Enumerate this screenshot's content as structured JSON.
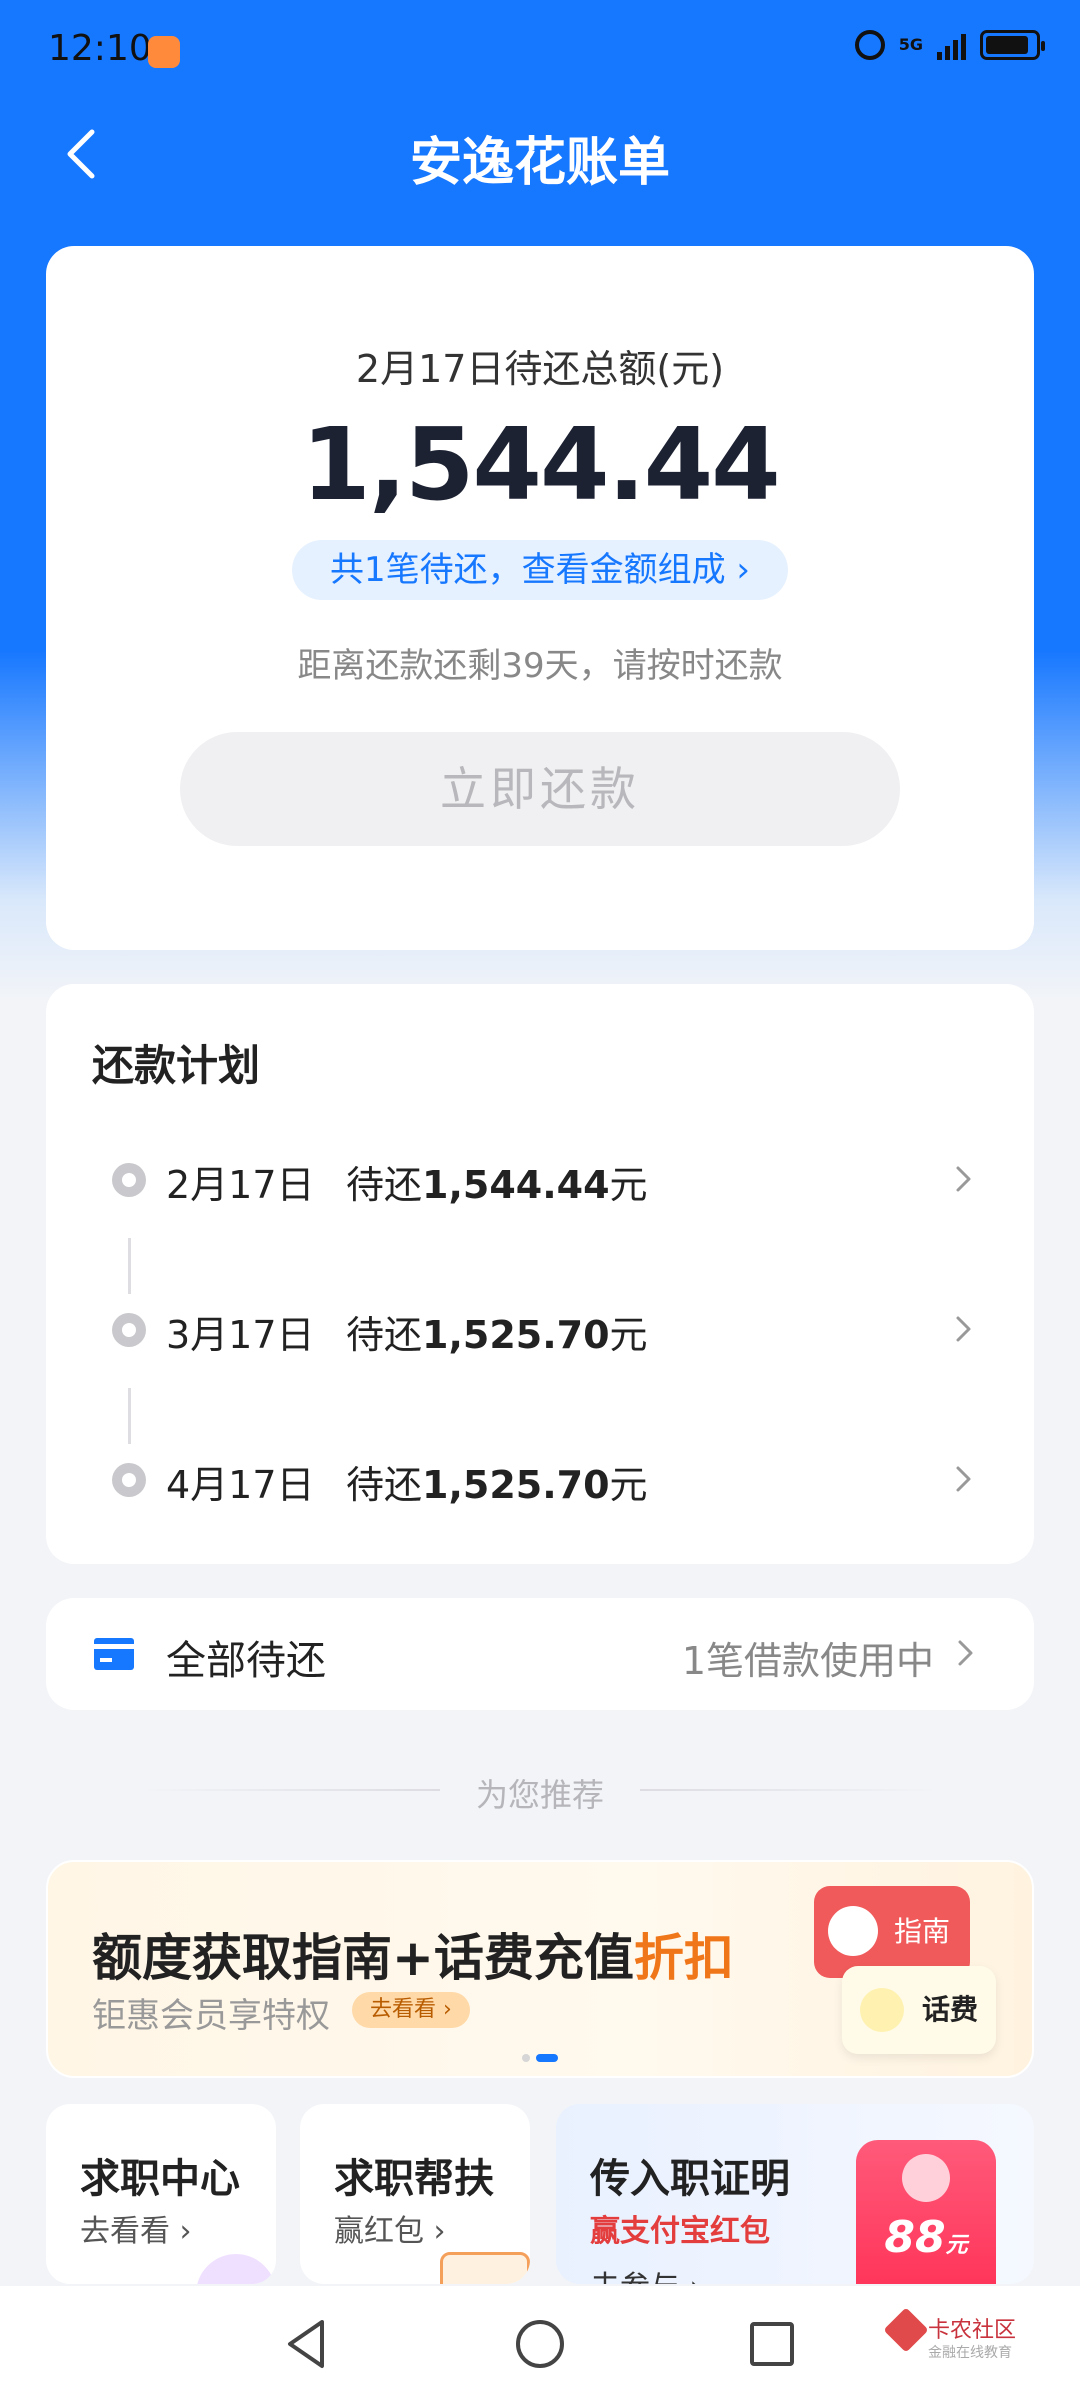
{
  "status_bar": {
    "time": "12:10",
    "network": "5G"
  },
  "header": {
    "title": "安逸花账单"
  },
  "summary": {
    "due_title": "2月17日待还总额(元)",
    "amount": "1,544.44",
    "breakdown_link": "共1笔待还，查看金额组成 ›",
    "remaining_text": "距离还款还剩39天，请按时还款",
    "pay_button": "立即还款"
  },
  "plan": {
    "title": "还款计划",
    "rows": [
      {
        "date": "2月17日",
        "pending_prefix": "待还",
        "amount": "1,544.44",
        "unit": "元"
      },
      {
        "date": "3月17日",
        "pending_prefix": "待还",
        "amount": "1,525.70",
        "unit": "元"
      },
      {
        "date": "4月17日",
        "pending_prefix": "待还",
        "amount": "1,525.70",
        "unit": "元"
      }
    ]
  },
  "all_pending": {
    "label": "全部待还",
    "status": "1笔借款使用中"
  },
  "recommend": {
    "divider": "为您推荐"
  },
  "banner": {
    "headline_main": "额度获取指南+话费充值",
    "headline_highlight": "折扣",
    "sub": "钜惠会员享特权",
    "tag": "去看看 ›",
    "guide_label": "指南",
    "phone_label": "话费",
    "carousel_index": 2,
    "carousel_count": 2
  },
  "tiles": [
    {
      "title": "求职中心",
      "sub": "去看看 ›"
    },
    {
      "title": "求职帮扶",
      "sub": "赢红包 ›"
    },
    {
      "title": "传入职证明",
      "sub": "赢支付宝红包",
      "sub2": "去参与 ›",
      "packet_value": "88",
      "packet_unit": "元"
    }
  ],
  "watermark": {
    "name": "卡农社区",
    "sub": "金融在线教育"
  },
  "colors": {
    "primary": "#1677ff",
    "highlight": "#f0761a",
    "red": "#e33d3d"
  }
}
